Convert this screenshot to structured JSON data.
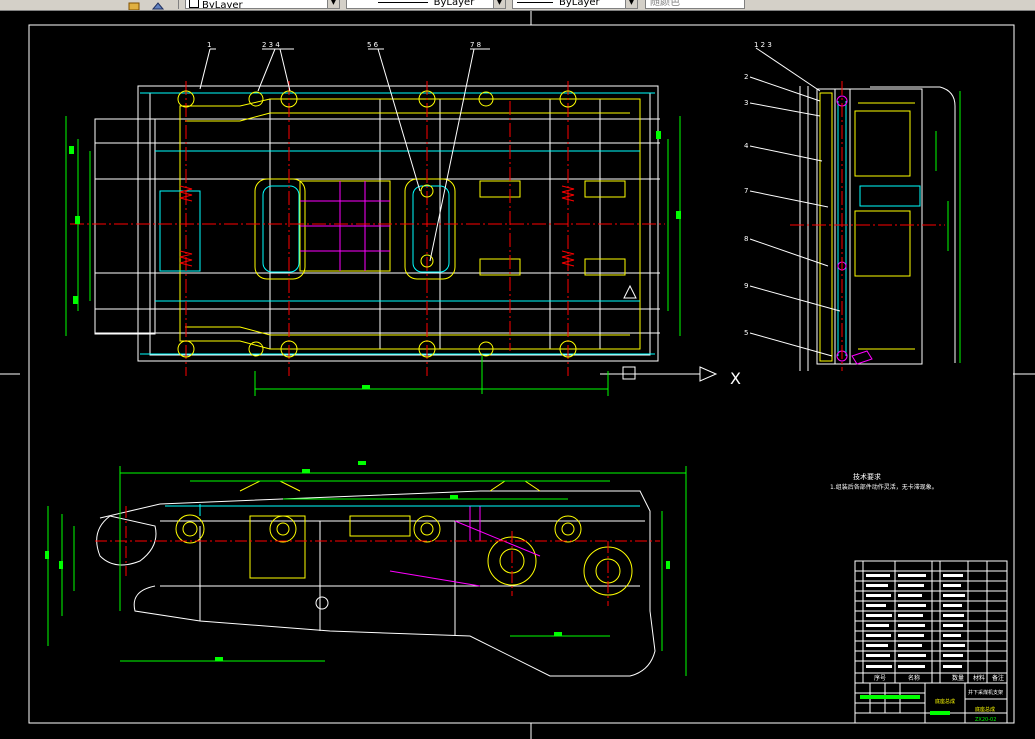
{
  "toolbar": {
    "layer_combo": "ByLayer",
    "linetype_combo": "ByLayer",
    "lineweight_combo": "ByLayer",
    "plotstyle_combo": "随颜色"
  },
  "drawing": {
    "axis_label": "X",
    "tech_title": "技术要求",
    "tech_note": "1.组装后各部件动作灵活，无卡滞现象。",
    "balloons_top": [
      "1",
      "2 3 4",
      "5 6",
      "7 8"
    ],
    "balloons_side": [
      "1 2 3",
      "2",
      "3",
      "4",
      "7",
      "8",
      "9",
      "5"
    ],
    "titleblock": {
      "col_labels": [
        "序号",
        "名称",
        "数量",
        "材料",
        "备注"
      ],
      "drawing_name": "井下采煤机支架",
      "part_name": "底座总成",
      "drawing_no": "ZX20-02"
    }
  },
  "colors": {
    "background": "#000000",
    "outline": "#ffffff",
    "dimension": "#00ff00",
    "center": "#ff0000",
    "hidden": "#00ffff",
    "detail": "#ffff00",
    "section": "#ff00ff"
  }
}
